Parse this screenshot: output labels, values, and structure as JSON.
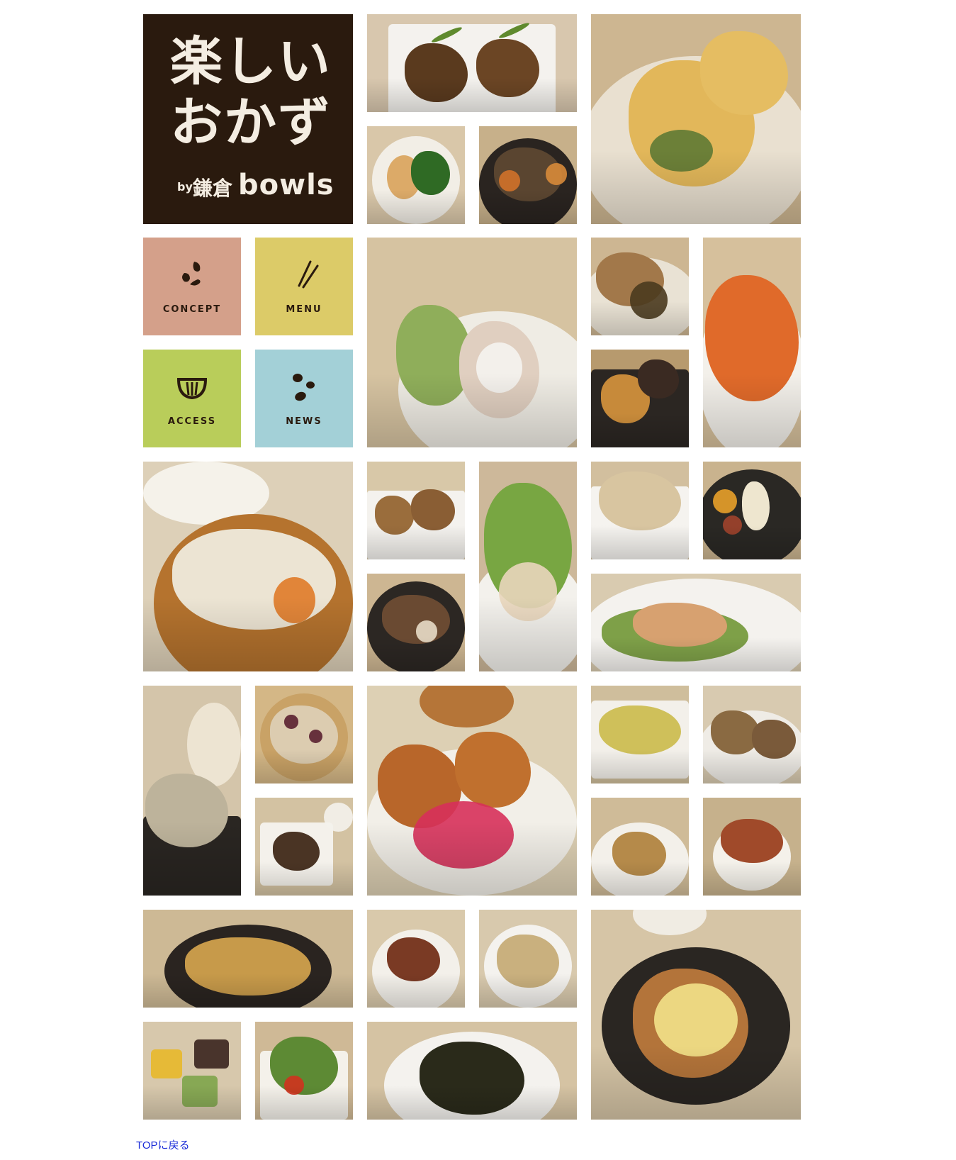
{
  "logo": {
    "line1": "楽しい",
    "line2": "おかず",
    "by": "by",
    "location": "鎌倉",
    "brand": "bowls"
  },
  "nav": [
    {
      "label": "CONCEPT",
      "icon": "beans-icon",
      "color": "#d4a08a"
    },
    {
      "label": "MENU",
      "icon": "chopsticks-icon",
      "color": "#dccb68"
    },
    {
      "label": "ACCESS",
      "icon": "bowl-icon",
      "color": "#b9cd5a"
    },
    {
      "label": "NEWS",
      "icon": "beans-icon",
      "color": "#a3d0d7"
    }
  ],
  "top_link": "TOPに戻る",
  "colors": {
    "logo_bg": "#2a1a0e",
    "link": "#1a2cd8"
  }
}
